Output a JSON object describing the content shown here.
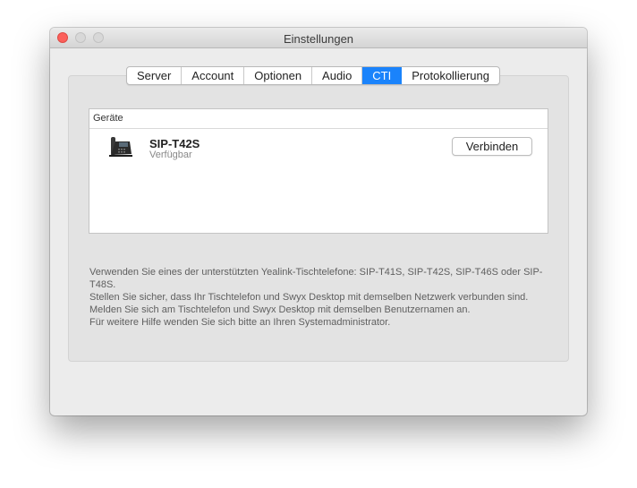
{
  "window": {
    "title": "Einstellungen"
  },
  "tabs": [
    {
      "label": "Server",
      "active": false
    },
    {
      "label": "Account",
      "active": false
    },
    {
      "label": "Optionen",
      "active": false
    },
    {
      "label": "Audio",
      "active": false
    },
    {
      "label": "CTI",
      "active": true
    },
    {
      "label": "Protokollierung",
      "active": false
    }
  ],
  "devices": {
    "header": "Geräte",
    "items": [
      {
        "name": "SIP-T42S",
        "status": "Verfügbar",
        "icon": "desk-phone-icon",
        "action_label": "Verbinden"
      }
    ]
  },
  "help": {
    "lines": [
      "Verwenden Sie eines der unterstützten Yealink-Tischtelefone: SIP-T41S, SIP-T42S, SIP-T46S oder SIP-T48S.",
      "Stellen Sie sicher, dass Ihr Tischtelefon und Swyx Desktop mit demselben Netzwerk verbunden sind.",
      "Melden Sie sich am Tischtelefon und Swyx Desktop mit demselben Benutzernamen an.",
      "Für weitere Hilfe wenden Sie sich bitte an Ihren Systemadministrator."
    ]
  },
  "colors": {
    "accent": "#1a83fb",
    "close_button": "#fc605b",
    "window_background": "#ececec"
  }
}
